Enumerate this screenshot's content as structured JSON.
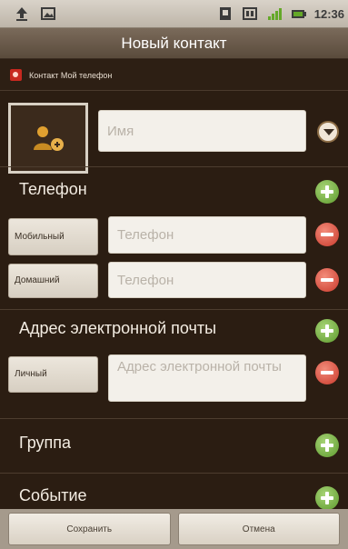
{
  "status_bar": {
    "time": "12:36"
  },
  "header": {
    "title": "Новый контакт"
  },
  "account": {
    "label": "Контакт Мой телефон"
  },
  "name": {
    "placeholder": "Имя"
  },
  "phone": {
    "title": "Телефон",
    "rows": [
      {
        "type": "Мобильный",
        "placeholder": "Телефон"
      },
      {
        "type": "Домашний",
        "placeholder": "Телефон"
      }
    ]
  },
  "email": {
    "title": "Адрес электронной почты",
    "rows": [
      {
        "type": "Личный",
        "placeholder": "Адрес электронной почты"
      }
    ]
  },
  "group": {
    "title": "Группа"
  },
  "event": {
    "title": "Событие"
  },
  "footer": {
    "save_label": "Сохранить",
    "cancel_label": "Отмена"
  }
}
